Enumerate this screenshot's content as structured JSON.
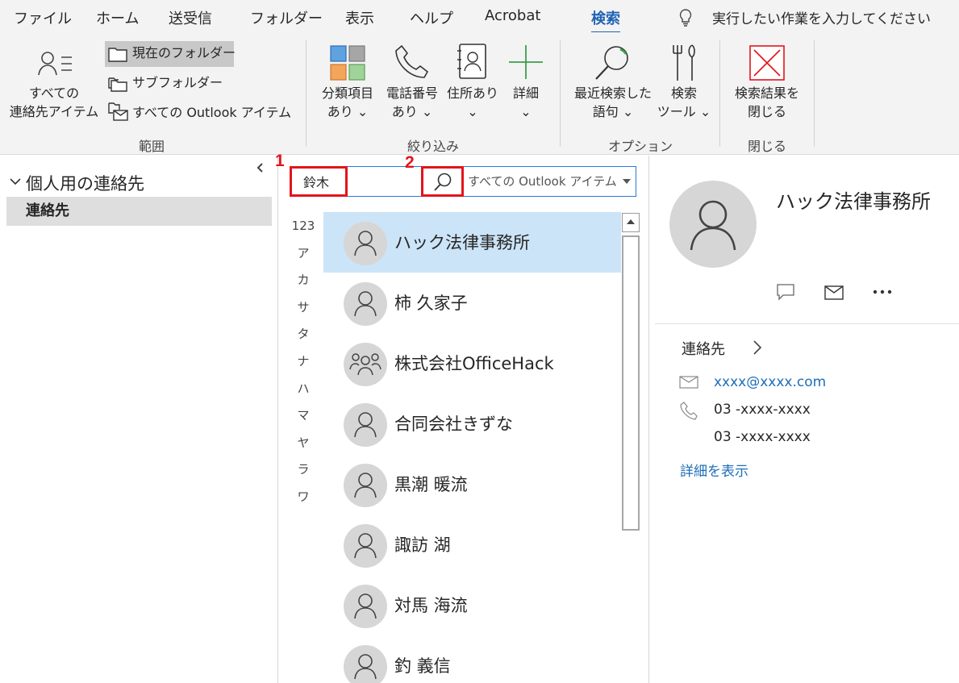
{
  "menu": {
    "tabs": [
      "ファイル",
      "ホーム",
      "送受信",
      "フォルダー",
      "表示",
      "ヘルプ",
      "Acrobat",
      "検索"
    ],
    "active_tab": "検索",
    "tell_me": "実行したい作業を入力してください"
  },
  "ribbon": {
    "all_contacts_line1": "すべての",
    "all_contacts_line2": "連絡先アイテム",
    "scope_current": "現在のフォルダー",
    "scope_sub": "サブフォルダー",
    "scope_all": "すべての Outlook アイテム",
    "group_scope": "範囲",
    "categorized_line1": "分類項目",
    "categorized_line2": "あり ⌄",
    "phone_line1": "電話番号",
    "phone_line2": "あり ⌄",
    "address_line1": "住所あり",
    "address_line2": "⌄",
    "more_line1": "詳細",
    "more_line2": "⌄",
    "group_refine": "絞り込み",
    "recent_line1": "最近検索した",
    "recent_line2": "語句 ⌄",
    "tools_line1": "検索",
    "tools_line2": "ツール ⌄",
    "group_options": "オプション",
    "close_line1": "検索結果を",
    "close_line2": "閉じる",
    "group_close": "閉じる"
  },
  "nav": {
    "header": "個人用の連絡先",
    "contacts": "連絡先"
  },
  "search": {
    "value": "鈴木",
    "scope": "すべての Outlook アイテム"
  },
  "steps": [
    "1",
    "2"
  ],
  "index": [
    "123",
    "ア",
    "カ",
    "サ",
    "タ",
    "ナ",
    "ハ",
    "マ",
    "ヤ",
    "ラ",
    "ワ"
  ],
  "contacts": [
    {
      "name": "ハック法律事務所",
      "icon": "person-icon"
    },
    {
      "name": "柿 久家子",
      "icon": "person-icon"
    },
    {
      "name": "株式会社OfficeHack",
      "icon": "group-icon"
    },
    {
      "name": "合同会社きずな",
      "icon": "person-icon"
    },
    {
      "name": "黒潮 暖流",
      "icon": "person-icon"
    },
    {
      "name": "諏訪 湖",
      "icon": "person-icon"
    },
    {
      "name": "対馬 海流",
      "icon": "person-icon"
    },
    {
      "name": "釣 義信",
      "icon": "person-icon"
    }
  ],
  "reading_pane": {
    "title": "ハック法律事務所",
    "section": "連絡先",
    "email": "xxxx@xxxx.com",
    "phone1": "03 -xxxx-xxxx",
    "phone2": "03 -xxxx-xxxx",
    "details_link": "詳細を表示"
  },
  "colors": {
    "accent": "#1e63b4",
    "highlight": "#e3141c",
    "selection": "#cce4f7"
  }
}
